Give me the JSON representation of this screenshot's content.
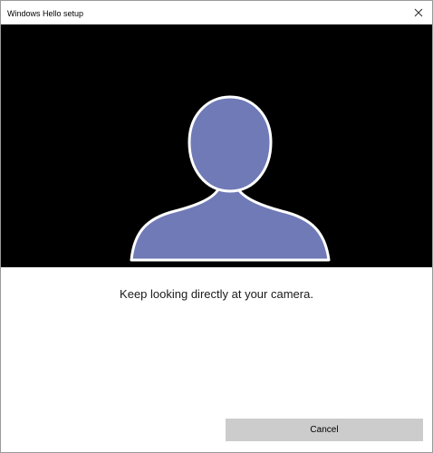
{
  "window": {
    "title": "Windows Hello setup"
  },
  "main": {
    "instruction": "Keep looking directly at your camera.",
    "cancel_label": "Cancel"
  },
  "colors": {
    "camera_background": "#000000",
    "silhouette_fill": "#6f7ab7",
    "silhouette_outline": "#ffffff",
    "button_background": "#cccccc"
  },
  "icons": {
    "close": "close-icon",
    "face": "face-silhouette-icon"
  }
}
